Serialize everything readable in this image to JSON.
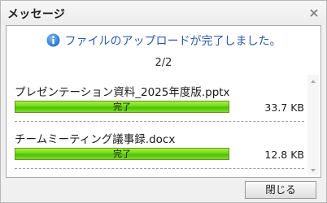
{
  "dialog": {
    "title": "メッセージ",
    "message": "ファイルのアップロードが完了しました。",
    "counter": "2/2",
    "close_label": "閉じる"
  },
  "files": [
    {
      "name": "プレゼンテーション資料_2025年度版.pptx",
      "status": "完了",
      "size": "33.7 KB",
      "progress": 1.0
    },
    {
      "name": "チームミーティング議事録.docx",
      "status": "完了",
      "size": "12.8 KB",
      "progress": 1.0
    }
  ],
  "colors": {
    "message_text": "#2a5aa6",
    "progress_green": "#5ccc12",
    "info_icon_blue": "#2f7fd6"
  },
  "icons": {
    "close": "close-icon",
    "info": "info-icon",
    "scroll_up": "scroll-up-arrow-icon",
    "scroll_down": "scroll-down-arrow-icon"
  }
}
